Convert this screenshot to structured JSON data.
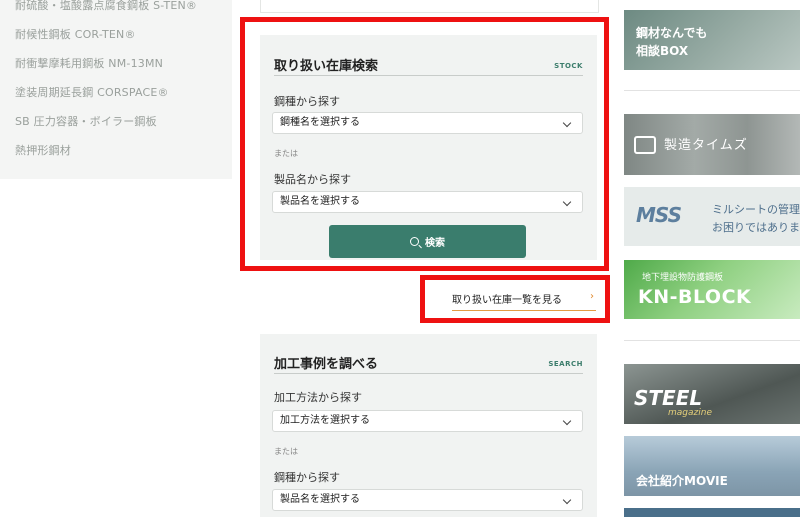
{
  "left_nav": {
    "items": [
      "耐硫酸・塩酸露点腐食鋼板 S-TEN®",
      "耐候性鋼板 COR-TEN®",
      "耐衝撃摩耗用鋼板 NM-13MN",
      "塗装周期延長鋼 CORSPACE®",
      "SB 圧力容器・ボイラー鋼板",
      "熱押形鋼材"
    ]
  },
  "stock_search": {
    "title": "取り扱い在庫検索",
    "title_en": "STOCK",
    "steel_label": "鋼種から探す",
    "steel_select": "鋼種名を選択する",
    "or_text": "または",
    "product_label": "製品名から探す",
    "product_select": "製品名を選択する",
    "search_button": "検索"
  },
  "stock_list_link": "取り扱い在庫一覧を見る",
  "process_search": {
    "title": "加工事例を調べる",
    "title_en": "SEARCH",
    "method_label": "加工方法から探す",
    "method_select": "加工方法を選択する",
    "or_text": "または",
    "steel_label": "鋼種から探す",
    "steel_select": "製品名を選択する"
  },
  "banners": {
    "consult": {
      "line1": "鋼材なんでも",
      "line2": "相談BOX"
    },
    "times": "製造タイムズ",
    "mss": {
      "logo": "MSS",
      "line1": "ミルシートの管理",
      "line2": "お困りではありま"
    },
    "knblock": {
      "small": "地下埋設物防護鋼板",
      "big": "KN-BLOCK"
    },
    "steel": {
      "big": "STEEL",
      "small": "magazine"
    },
    "movie": "会社紹介MOVIE"
  },
  "colors": {
    "accent": "#3a7d6d",
    "highlight_red": "#ee1111",
    "link_arrow": "#e08a2e"
  }
}
